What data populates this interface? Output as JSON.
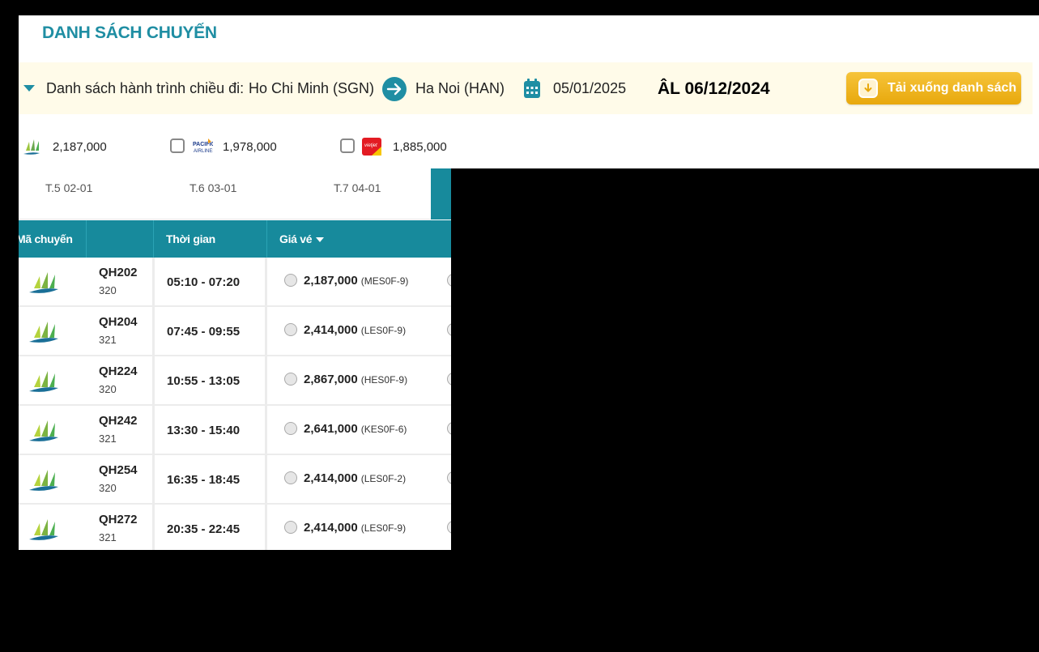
{
  "header": {
    "title": "DANH SÁCH CHUYẾN"
  },
  "route": {
    "label": "Danh sách hành trình chiều đi:",
    "origin": "Ho Chi Minh (SGN)",
    "destination": "Ha Noi (HAN)",
    "date": "05/01/2025",
    "lunar_date": "ÂL 06/12/2024",
    "download_label": "Tải xuống danh sách"
  },
  "filters": [
    {
      "airline": "bamboo-airways",
      "price": "2,187,000",
      "checkbox": false
    },
    {
      "airline": "pacific-airlines",
      "price": "1,978,000",
      "checkbox": true
    },
    {
      "airline": "vietjet-air",
      "price": "1,885,000",
      "checkbox": true
    }
  ],
  "date_tabs": [
    "T.5 02-01",
    "T.6 03-01",
    "T.7 04-01"
  ],
  "table": {
    "headers": {
      "flight": "Mã chuyến",
      "time": "Thời gian",
      "price": "Giá vé"
    },
    "rows": [
      {
        "flight_no": "QH202",
        "aircraft": "320",
        "time": "05:10 - 07:20",
        "price": "2,187,000",
        "fare_class": "(MES0F-9)"
      },
      {
        "flight_no": "QH204",
        "aircraft": "321",
        "time": "07:45 - 09:55",
        "price": "2,414,000",
        "fare_class": "(LES0F-9)"
      },
      {
        "flight_no": "QH224",
        "aircraft": "320",
        "time": "10:55 - 13:05",
        "price": "2,867,000",
        "fare_class": "(HES0F-9)"
      },
      {
        "flight_no": "QH242",
        "aircraft": "321",
        "time": "13:30 - 15:40",
        "price": "2,641,000",
        "fare_class": "(KES0F-6)"
      },
      {
        "flight_no": "QH254",
        "aircraft": "320",
        "time": "16:35 - 18:45",
        "price": "2,414,000",
        "fare_class": "(LES0F-2)"
      },
      {
        "flight_no": "QH272",
        "aircraft": "321",
        "time": "20:35 - 22:45",
        "price": "2,414,000",
        "fare_class": "(LES0F-9)"
      }
    ]
  },
  "colors": {
    "accent": "#1f8ea3",
    "header_bg": "#178a9c",
    "route_bg": "#fffbe9",
    "button": "#f0b523"
  }
}
